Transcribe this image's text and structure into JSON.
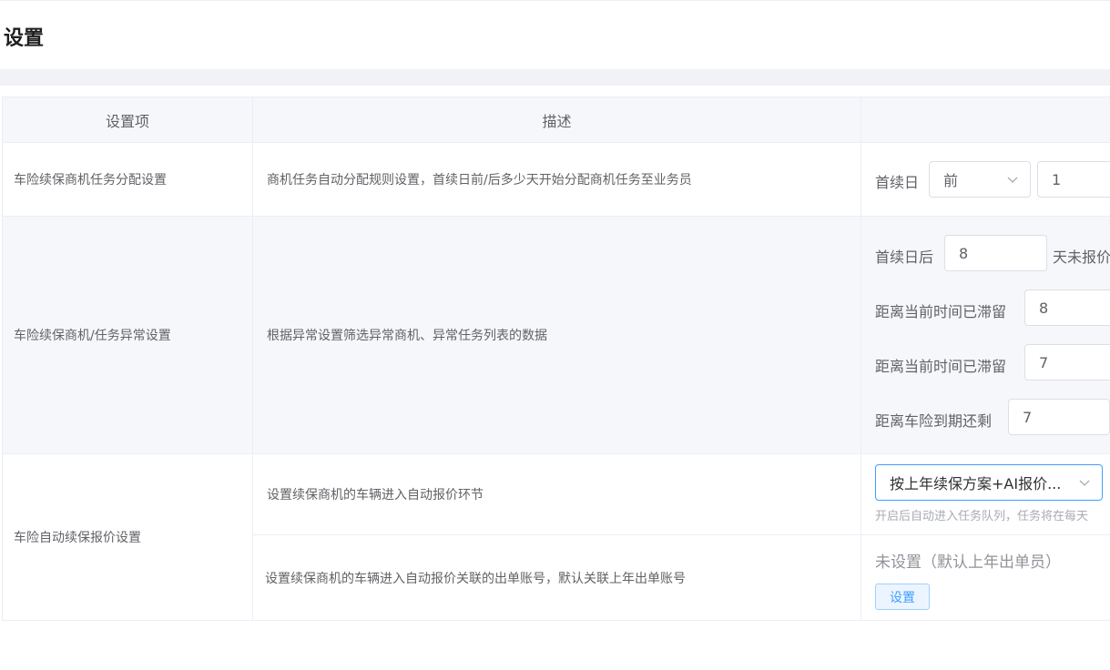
{
  "page": {
    "title": "设置"
  },
  "table": {
    "headers": [
      "设置项",
      "描述",
      ""
    ],
    "rows": [
      {
        "name": "车险续保商机任务分配设置",
        "description": "商机任务自动分配规则设置，首续日前/后多少天开始分配商机任务至业务员",
        "controls": {
          "label": "首续日",
          "select_value": "前",
          "days_value": "1"
        }
      },
      {
        "name": "车险续保商机/任务异常设置",
        "description": "根据异常设置筛选异常商机、异常任务列表的数据",
        "controls": [
          {
            "label": "首续日后",
            "value": "8",
            "suffix": "天未报价"
          },
          {
            "label": "距离当前时间已滞留",
            "value": "8"
          },
          {
            "label": "距离当前时间已滞留",
            "value": "7"
          },
          {
            "label": "距离车险到期还剩",
            "value": "7"
          }
        ]
      },
      {
        "name": "车险自动续保报价设置",
        "sub_rows": [
          {
            "description": "设置续保商机的车辆进入自动报价环节",
            "select_value": "按上年续保方案+AI报价...",
            "hint": "开启后自动进入任务队列，任务将在每天"
          },
          {
            "description": "设置续保商机的车辆进入自动报价关联的出单账号，默认关联上年出单账号",
            "status": "未设置（默认上年出单员）",
            "button_label": "设置"
          }
        ]
      }
    ]
  },
  "icons": {
    "chevron": "chevron-down-icon"
  },
  "colors": {
    "accent": "#409eff",
    "header_bg": "#f5f7fa",
    "border": "#ebeef5"
  }
}
